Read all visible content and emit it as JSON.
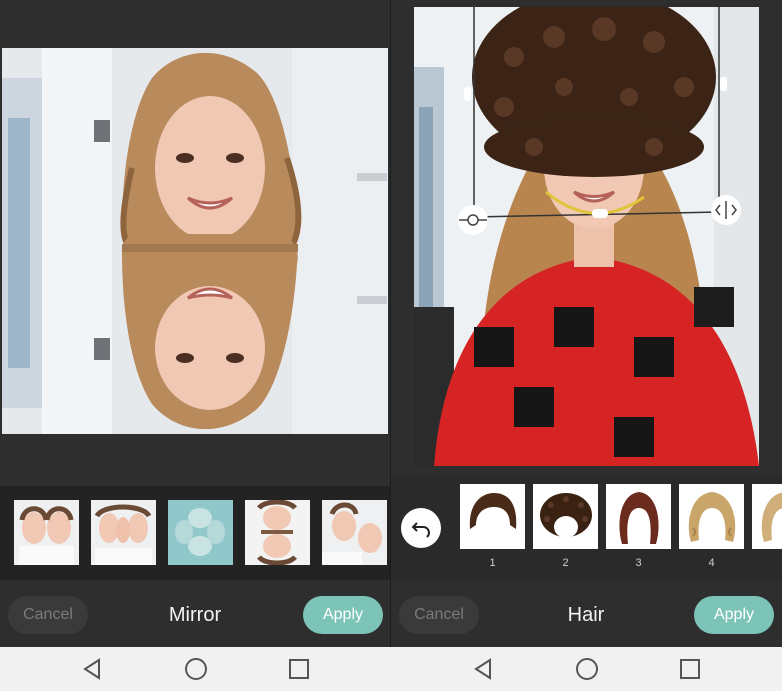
{
  "left_panel": {
    "title": "Mirror",
    "cancel_label": "Cancel",
    "apply_label": "Apply",
    "thumbnails": [
      "mirror-effect-1",
      "mirror-effect-2",
      "mirror-effect-3",
      "mirror-effect-4",
      "mirror-effect-5"
    ]
  },
  "right_panel": {
    "title": "Hair",
    "cancel_label": "Cancel",
    "apply_label": "Apply",
    "hair_styles": [
      {
        "number": "1",
        "icon": "short-dark-hair-icon"
      },
      {
        "number": "2",
        "icon": "afro-hair-icon"
      },
      {
        "number": "3",
        "icon": "long-auburn-hair-icon"
      },
      {
        "number": "4",
        "icon": "blonde-wavy-hair-icon"
      }
    ]
  },
  "nav": {
    "icons": [
      "back-triangle-icon",
      "home-circle-icon",
      "recents-square-icon"
    ]
  },
  "colors": {
    "accent": "#7cc3b8",
    "panel_bg": "#2e2e2e",
    "nav_bg": "#f1f1f1"
  }
}
